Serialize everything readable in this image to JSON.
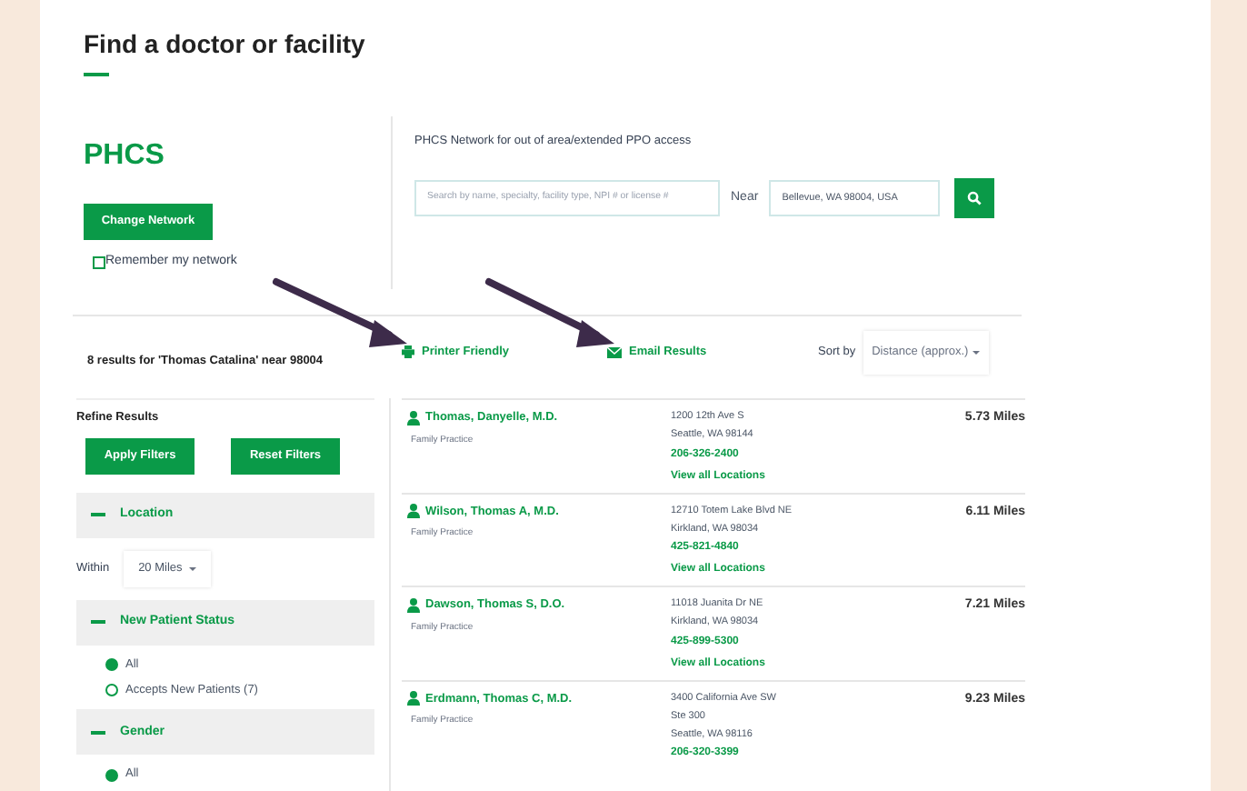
{
  "page_title": "Find a doctor or facility",
  "network": {
    "name": "PHCS",
    "change_button": "Change Network",
    "remember": {
      "label": "Remember my network",
      "checked": false
    }
  },
  "search": {
    "description": "PHCS Network for out of area/extended PPO access",
    "placeholder": "Search by name, specialty, facility type, NPI # or license #",
    "near_label": "Near",
    "location": "Bellevue, WA 98004, USA"
  },
  "results_bar": {
    "summary": "8 results for 'Thomas Catalina' near 98004",
    "printer": "Printer Friendly",
    "email": "Email Results",
    "sort_label": "Sort by",
    "sort_value": "Distance (approx.)"
  },
  "filters": {
    "title": "Refine Results",
    "apply": "Apply Filters",
    "reset": "Reset Filters",
    "sections": [
      {
        "kind": "select",
        "title": "Location",
        "expanded": true,
        "label": "Within",
        "value": "20 Miles"
      },
      {
        "kind": "radio",
        "title": "New Patient Status",
        "expanded": true,
        "options": [
          {
            "label": "All",
            "selected": true
          },
          {
            "label": "Accepts New Patients (7)",
            "selected": false
          }
        ]
      },
      {
        "kind": "radio",
        "title": "Gender",
        "expanded": true,
        "options": [
          {
            "label": "All",
            "selected": true
          }
        ]
      }
    ]
  },
  "results": [
    {
      "name": "Thomas, Danyelle, M.D.",
      "specialty": "Family Practice",
      "address": [
        "1200 12th Ave S",
        "Seattle, WA 98144"
      ],
      "phone": "206-326-2400",
      "link": "View all Locations",
      "distance": "5.73 Miles"
    },
    {
      "name": "Wilson, Thomas A, M.D.",
      "specialty": "Family Practice",
      "address": [
        "12710 Totem Lake Blvd NE",
        "Kirkland, WA 98034"
      ],
      "phone": "425-821-4840",
      "link": "View all Locations",
      "distance": "6.11 Miles"
    },
    {
      "name": "Dawson, Thomas S, D.O.",
      "specialty": "Family Practice",
      "address": [
        "11018 Juanita Dr NE",
        "Kirkland, WA 98034"
      ],
      "phone": "425-899-5300",
      "link": "View all Locations",
      "distance": "7.21 Miles"
    },
    {
      "name": "Erdmann, Thomas C, M.D.",
      "specialty": "Family Practice",
      "address": [
        "3400 California Ave SW",
        "Ste 300",
        "Seattle, WA 98116"
      ],
      "phone": "206-320-3399",
      "distance": "9.23 Miles"
    }
  ]
}
